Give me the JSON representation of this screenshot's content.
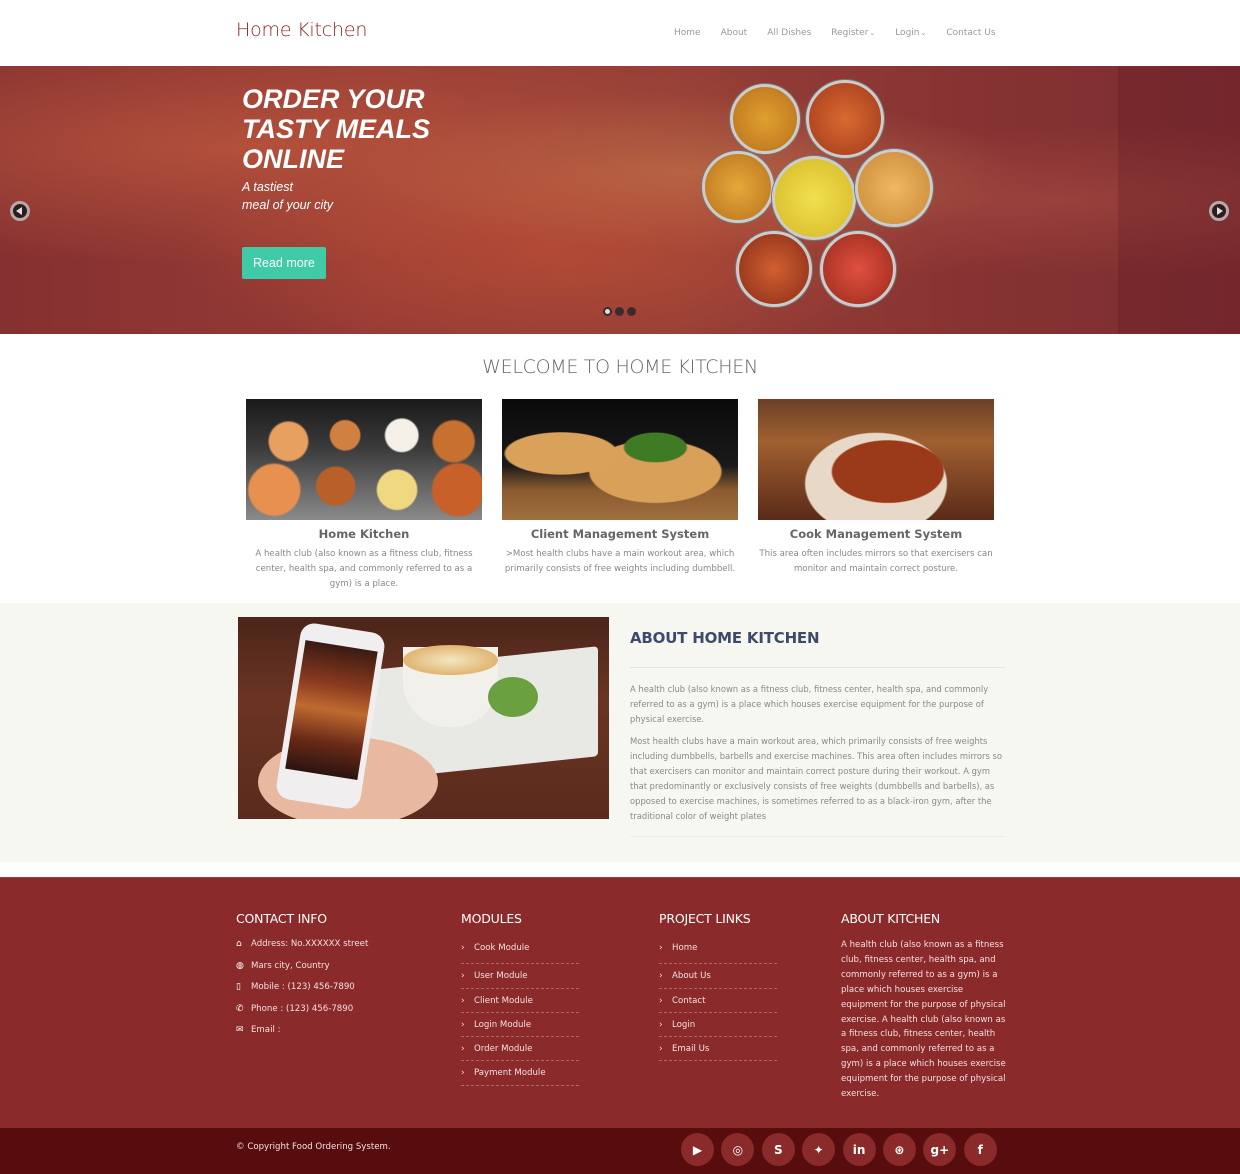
{
  "header": {
    "logo": "Home Kitchen",
    "nav": [
      {
        "label": "Home",
        "dropdown": false
      },
      {
        "label": "About",
        "dropdown": false
      },
      {
        "label": "All Dishes",
        "dropdown": false
      },
      {
        "label": "Register",
        "dropdown": true
      },
      {
        "label": "Login",
        "dropdown": true
      },
      {
        "label": "Contact Us",
        "dropdown": false
      }
    ]
  },
  "hero": {
    "title": "ORDER YOUR TASTY MEALS ONLINE",
    "subtitle_line1": "A tastiest",
    "subtitle_line2": "meal of your city",
    "button": "Read more",
    "slides": 3,
    "active_slide": 1,
    "prev_icon": "arrow-left-circle",
    "next_icon": "arrow-right-circle",
    "accent_color": "#3fcba8"
  },
  "welcome": {
    "title": "WELCOME TO HOME KITCHEN",
    "cards": [
      {
        "title": "Home Kitchen",
        "text": "A health club (also known as a fitness club, fitness center, health spa, and commonly referred to as a gym) is a place."
      },
      {
        "title": "Client Management System",
        "text": ">Most health clubs have a main workout area, which primarily consists of free weights including dumbbell."
      },
      {
        "title": "Cook Management System",
        "text": "This area often includes mirrors so that exercisers can monitor and maintain correct posture."
      }
    ]
  },
  "about": {
    "title": "ABOUT HOME KITCHEN",
    "paragraph1": "A health club (also known as a fitness club, fitness center, health spa, and commonly referred to as a gym) is a place which houses exercise equipment for the purpose of physical exercise.",
    "paragraph2": "Most health clubs have a main workout area, which primarily consists of free weights including dumbbells, barbells and exercise machines. This area often includes mirrors so that exercisers can monitor and maintain correct posture during their workout. A gym that predominantly or exclusively consists of free weights (dumbbells and barbells), as opposed to exercise machines, is sometimes referred to as a black-iron gym, after the traditional color of weight plates"
  },
  "footer": {
    "contact": {
      "title": "CONTACT INFO",
      "items": [
        {
          "icon": "home-icon",
          "glyph": "⌂",
          "text": "Address: No.XXXXXX street"
        },
        {
          "icon": "globe-icon",
          "glyph": "◍",
          "text": "Mars city, Country"
        },
        {
          "icon": "mobile-icon",
          "glyph": "▯",
          "text": "Mobile : (123) 456-7890"
        },
        {
          "icon": "phone-icon",
          "glyph": "✆",
          "text": "Phone : (123) 456-7890"
        },
        {
          "icon": "envelope-icon",
          "glyph": "✉",
          "text": "Email :"
        }
      ]
    },
    "modules": {
      "title": "MODULES",
      "items": [
        "Cook Module",
        "User Module",
        "Client Module",
        "Login Module",
        "Order Module",
        "Payment Module"
      ]
    },
    "project_links": {
      "title": "PROJECT LINKS",
      "items": [
        "Home",
        "About Us",
        "Contact",
        "Login",
        "Email Us"
      ]
    },
    "about": {
      "title": "ABOUT KITCHEN",
      "text": "A health club (also known as a fitness club, fitness center, health spa, and commonly referred to as a gym) is a place which houses exercise equipment for the purpose of physical exercise. A health club (also known as a fitness club, fitness center, health spa, and commonly referred to as a gym) is a place which houses exercise equipment for the purpose of physical exercise."
    },
    "copyright": "© Copyright Food Ordering System.",
    "socials": [
      {
        "name": "youtube",
        "glyph": "▶"
      },
      {
        "name": "github",
        "glyph": "◎"
      },
      {
        "name": "skype",
        "glyph": "S"
      },
      {
        "name": "twitter",
        "glyph": "✦"
      },
      {
        "name": "linkedin",
        "glyph": "in"
      },
      {
        "name": "dribbble",
        "glyph": "⊛"
      },
      {
        "name": "google-plus",
        "glyph": "g+"
      },
      {
        "name": "facebook",
        "glyph": "f"
      }
    ],
    "colors": {
      "primary": "#8a2a2b",
      "dark": "#570c0e"
    }
  }
}
